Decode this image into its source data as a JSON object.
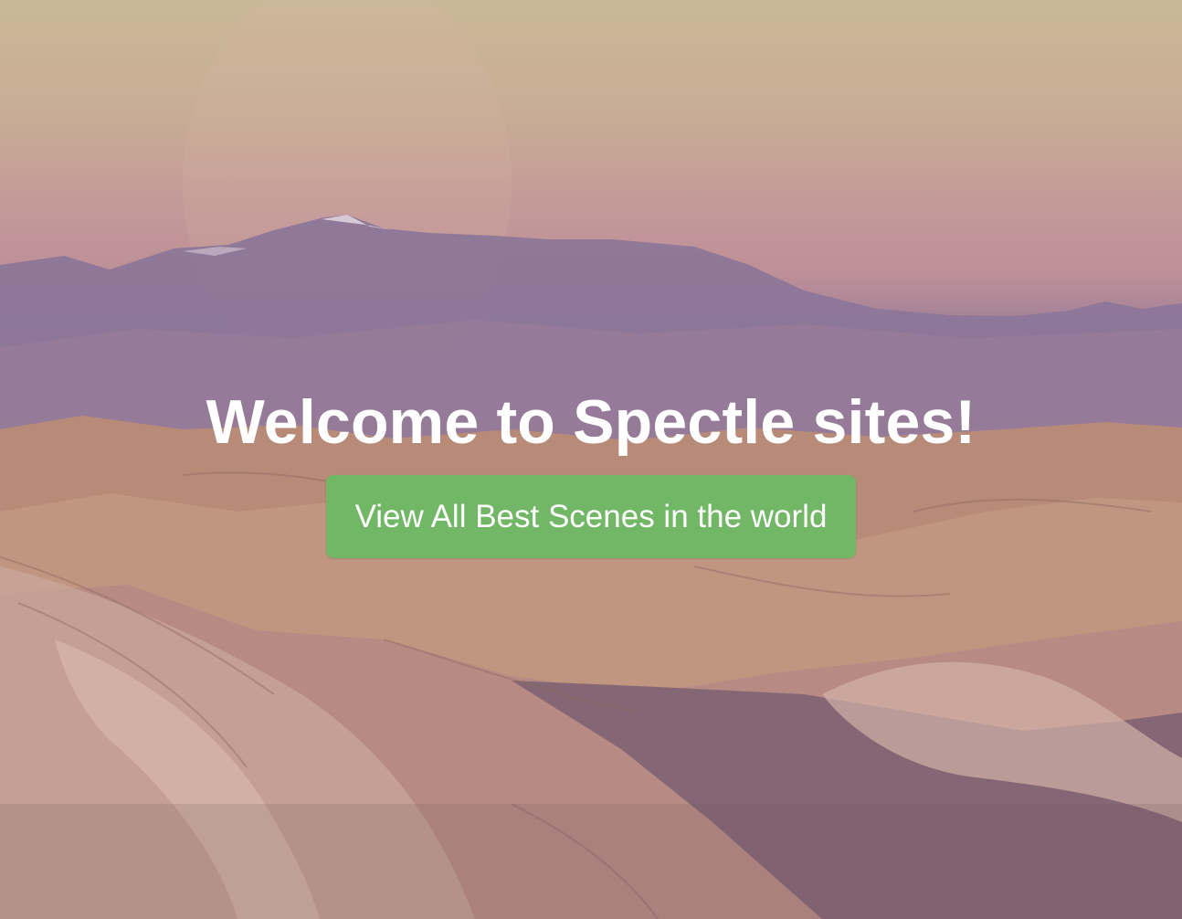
{
  "hero": {
    "title": "Welcome to Spectle sites!",
    "cta_label": "View All Best Scenes in the world",
    "button_color": "#72b765"
  }
}
